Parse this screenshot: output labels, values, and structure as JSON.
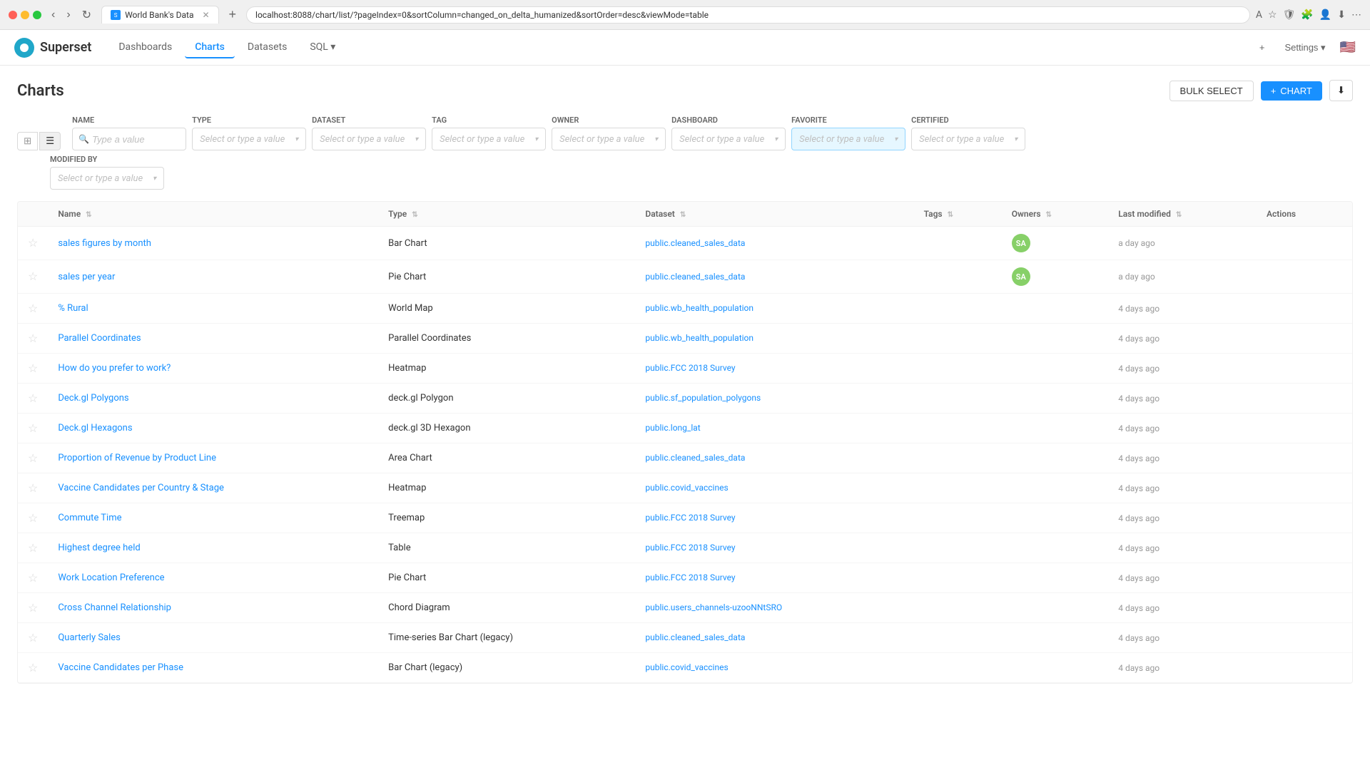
{
  "browser": {
    "tab_title": "World Bank's Data",
    "url": "localhost:8088/chart/list/?pageIndex=0&sortColumn=changed_on_delta_humanized&sortOrder=desc&viewMode=table",
    "dots": [
      "red",
      "yellow",
      "green"
    ]
  },
  "app": {
    "logo_text": "Superset",
    "nav": [
      {
        "label": "Dashboards",
        "active": false
      },
      {
        "label": "Charts",
        "active": true
      },
      {
        "label": "Datasets",
        "active": false
      },
      {
        "label": "SQL ▾",
        "active": false
      }
    ],
    "header_right": {
      "plus_label": "+",
      "settings_label": "Settings ▾"
    }
  },
  "page": {
    "title": "Charts",
    "bulk_select_label": "BULK SELECT",
    "add_chart_label": "+ CHART",
    "download_label": "⬇"
  },
  "filters": {
    "name_label": "NAME",
    "name_placeholder": "Type a value",
    "type_label": "TYPE",
    "type_placeholder": "Select or type a value",
    "dataset_label": "DATASET",
    "dataset_placeholder": "Select or type a value",
    "tag_label": "TAG",
    "tag_placeholder": "Select or type a value",
    "owner_label": "OWNER",
    "owner_placeholder": "Select or type a value",
    "dashboard_label": "DASHBOARD",
    "dashboard_placeholder": "Select or type a value",
    "favorite_label": "FAVORITE",
    "favorite_placeholder": "Select or type a value",
    "certified_label": "CERTIFIED",
    "certified_placeholder": "Select or type a value",
    "modified_by_label": "MODIFIED BY",
    "modified_by_placeholder": "Select or type a value"
  },
  "table": {
    "columns": [
      {
        "key": "name",
        "label": "Name"
      },
      {
        "key": "type",
        "label": "Type"
      },
      {
        "key": "dataset",
        "label": "Dataset"
      },
      {
        "key": "tags",
        "label": "Tags"
      },
      {
        "key": "owners",
        "label": "Owners"
      },
      {
        "key": "last_modified",
        "label": "Last modified"
      },
      {
        "key": "actions",
        "label": "Actions"
      }
    ],
    "rows": [
      {
        "name": "sales figures by month",
        "type": "Bar Chart",
        "dataset": "public.cleaned_sales_data",
        "tags": "",
        "has_owner": true,
        "owner_initials": "SA",
        "last_modified": "a day ago"
      },
      {
        "name": "sales per year",
        "type": "Pie Chart",
        "dataset": "public.cleaned_sales_data",
        "tags": "",
        "has_owner": true,
        "owner_initials": "SA",
        "last_modified": "a day ago"
      },
      {
        "name": "% Rural",
        "type": "World Map",
        "dataset": "public.wb_health_population",
        "tags": "",
        "has_owner": false,
        "owner_initials": "",
        "last_modified": "4 days ago"
      },
      {
        "name": "Parallel Coordinates",
        "type": "Parallel Coordinates",
        "dataset": "public.wb_health_population",
        "tags": "",
        "has_owner": false,
        "owner_initials": "",
        "last_modified": "4 days ago"
      },
      {
        "name": "How do you prefer to work?",
        "type": "Heatmap",
        "dataset": "public.FCC 2018 Survey",
        "tags": "",
        "has_owner": false,
        "owner_initials": "",
        "last_modified": "4 days ago"
      },
      {
        "name": "Deck.gl Polygons",
        "type": "deck.gl Polygon",
        "dataset": "public.sf_population_polygons",
        "tags": "",
        "has_owner": false,
        "owner_initials": "",
        "last_modified": "4 days ago"
      },
      {
        "name": "Deck.gl Hexagons",
        "type": "deck.gl 3D Hexagon",
        "dataset": "public.long_lat",
        "tags": "",
        "has_owner": false,
        "owner_initials": "",
        "last_modified": "4 days ago"
      },
      {
        "name": "Proportion of Revenue by Product Line",
        "type": "Area Chart",
        "dataset": "public.cleaned_sales_data",
        "tags": "",
        "has_owner": false,
        "owner_initials": "",
        "last_modified": "4 days ago"
      },
      {
        "name": "Vaccine Candidates per Country & Stage",
        "type": "Heatmap",
        "dataset": "public.covid_vaccines",
        "tags": "",
        "has_owner": false,
        "owner_initials": "",
        "last_modified": "4 days ago"
      },
      {
        "name": "Commute Time",
        "type": "Treemap",
        "dataset": "public.FCC 2018 Survey",
        "tags": "",
        "has_owner": false,
        "owner_initials": "",
        "last_modified": "4 days ago"
      },
      {
        "name": "Highest degree held",
        "type": "Table",
        "dataset": "public.FCC 2018 Survey",
        "tags": "",
        "has_owner": false,
        "owner_initials": "",
        "last_modified": "4 days ago"
      },
      {
        "name": "Work Location Preference",
        "type": "Pie Chart",
        "dataset": "public.FCC 2018 Survey",
        "tags": "",
        "has_owner": false,
        "owner_initials": "",
        "last_modified": "4 days ago"
      },
      {
        "name": "Cross Channel Relationship",
        "type": "Chord Diagram",
        "dataset": "public.users_channels-uzooNNtSRO",
        "tags": "",
        "has_owner": false,
        "owner_initials": "",
        "last_modified": "4 days ago"
      },
      {
        "name": "Quarterly Sales",
        "type": "Time-series Bar Chart (legacy)",
        "dataset": "public.cleaned_sales_data",
        "tags": "",
        "has_owner": false,
        "owner_initials": "",
        "last_modified": "4 days ago"
      },
      {
        "name": "Vaccine Candidates per Phase",
        "type": "Bar Chart (legacy)",
        "dataset": "public.covid_vaccines",
        "tags": "",
        "has_owner": false,
        "owner_initials": "",
        "last_modified": "4 days ago"
      }
    ]
  }
}
